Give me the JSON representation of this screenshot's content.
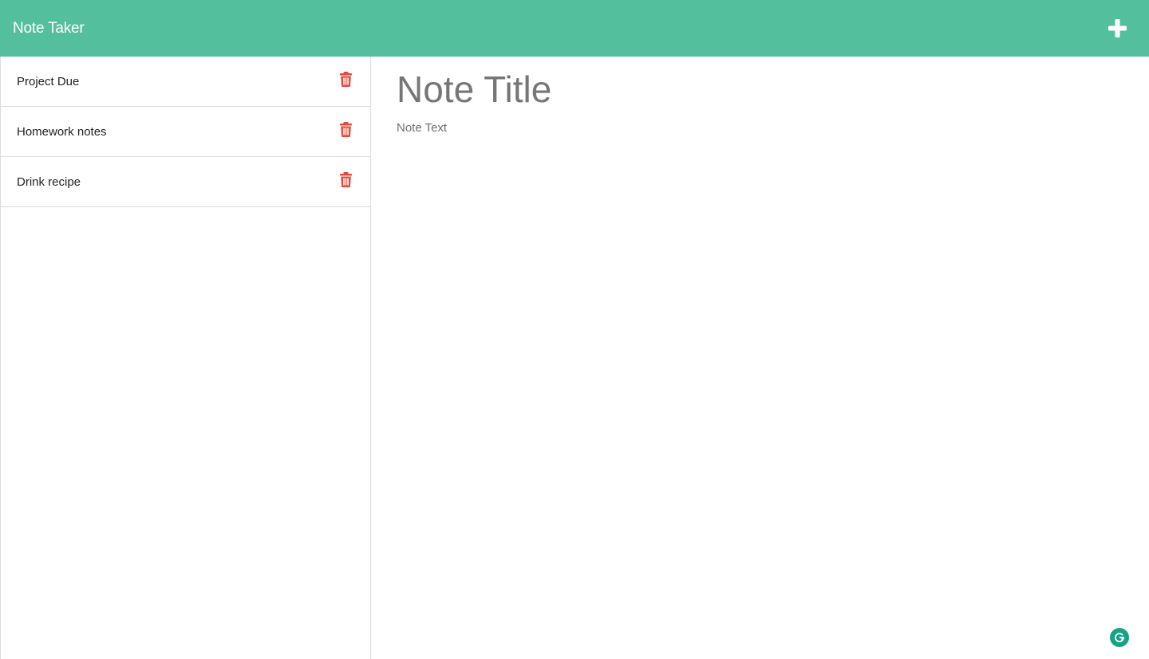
{
  "app": {
    "title": "Note Taker"
  },
  "header": {
    "new_note_icon": "plus-icon",
    "bg_color": "#54bf9c"
  },
  "sidebar": {
    "notes": [
      {
        "title": "Project Due"
      },
      {
        "title": "Homework notes"
      },
      {
        "title": "Drink recipe"
      }
    ],
    "delete_icon": "trash-icon",
    "delete_color": "#e24c3e"
  },
  "editor": {
    "title_placeholder": "Note Title",
    "text_placeholder": "Note Text",
    "title_value": "",
    "text_value": ""
  },
  "widget": {
    "icon": "grammarly-icon",
    "color": "#15a383"
  }
}
